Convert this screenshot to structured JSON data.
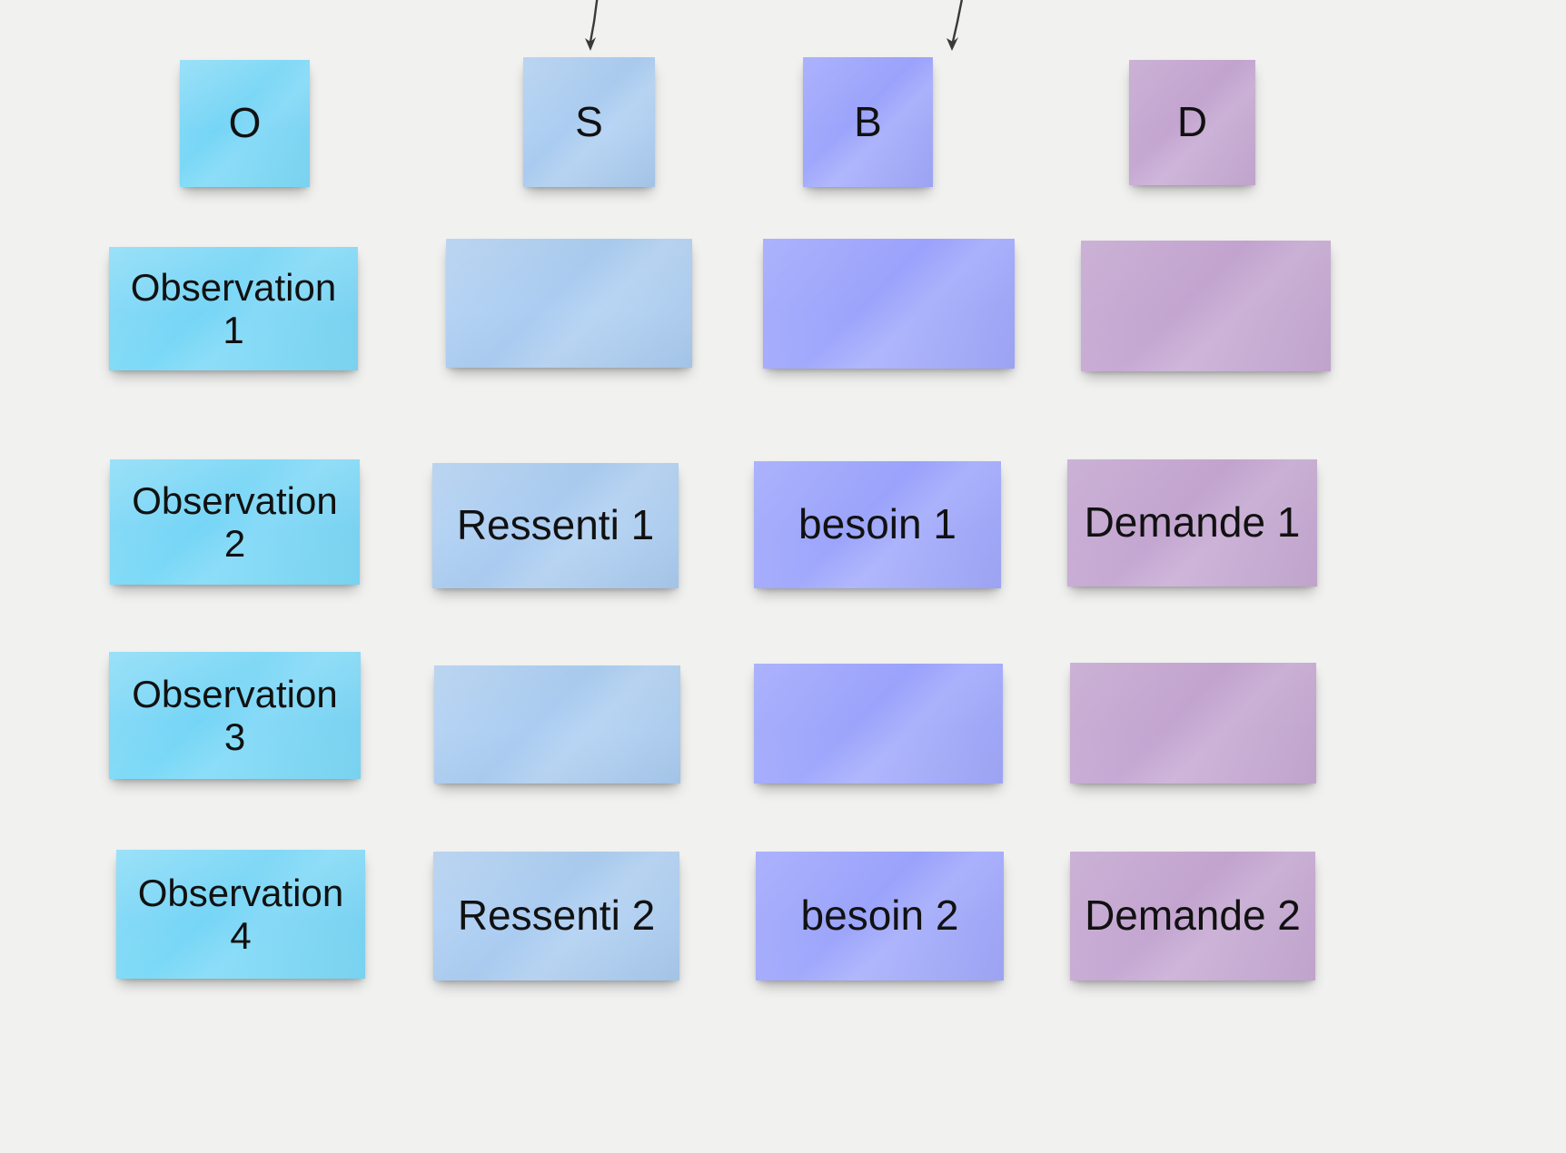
{
  "board": {
    "background_color": "#f1f1f0",
    "title_hidden": true
  },
  "columns": [
    {
      "key": "O",
      "header_label": "O",
      "color": "#7ed9f5",
      "name": "observation-column"
    },
    {
      "key": "S",
      "header_label": "S",
      "color": "#a9cbef",
      "name": "ressenti-column"
    },
    {
      "key": "B",
      "header_label": "B",
      "color": "#9aa3fb",
      "name": "besoin-column"
    },
    {
      "key": "D",
      "header_label": "D",
      "color": "#c3a4ce",
      "name": "demande-column"
    }
  ],
  "headers": [
    {
      "label": "O",
      "column": "O"
    },
    {
      "label": "S",
      "column": "S"
    },
    {
      "label": "B",
      "column": "B"
    },
    {
      "label": "D",
      "column": "D"
    }
  ],
  "arrows": [
    {
      "target": "S",
      "direction": "down"
    },
    {
      "target": "B",
      "direction": "down"
    }
  ],
  "rows": [
    {
      "index": 1,
      "notes": [
        {
          "column": "O",
          "text": "Observation 1"
        },
        {
          "column": "S",
          "text": ""
        },
        {
          "column": "B",
          "text": ""
        },
        {
          "column": "D",
          "text": ""
        }
      ]
    },
    {
      "index": 2,
      "notes": [
        {
          "column": "O",
          "text": "Observation 2"
        },
        {
          "column": "S",
          "text": "Ressenti 1"
        },
        {
          "column": "B",
          "text": "besoin 1"
        },
        {
          "column": "D",
          "text": "Demande 1"
        }
      ]
    },
    {
      "index": 3,
      "notes": [
        {
          "column": "O",
          "text": "Observation 3"
        },
        {
          "column": "S",
          "text": ""
        },
        {
          "column": "B",
          "text": ""
        },
        {
          "column": "D",
          "text": ""
        }
      ]
    },
    {
      "index": 4,
      "notes": [
        {
          "column": "O",
          "text": "Observation 4"
        },
        {
          "column": "S",
          "text": "Ressenti 2"
        },
        {
          "column": "B",
          "text": "besoin 2"
        },
        {
          "column": "D",
          "text": "Demande 2"
        }
      ]
    }
  ]
}
